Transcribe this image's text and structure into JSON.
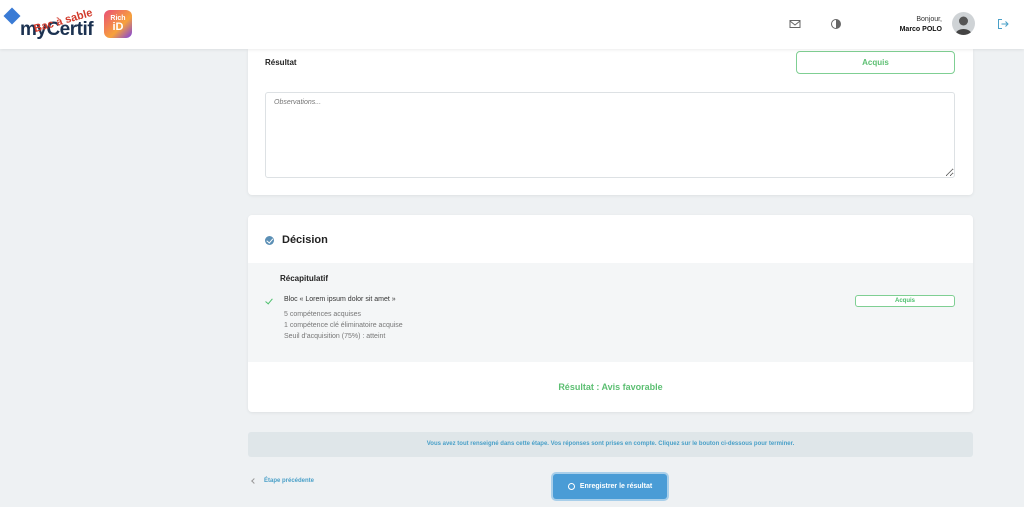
{
  "header": {
    "logo_text": "myCertif",
    "logo_sandbox": "Bac à sable",
    "richid_top": "Rich",
    "richid_bottom": "iD",
    "greeting": "Bonjour,",
    "user_name": "Marco POLO",
    "icons": [
      "mail-icon",
      "theme-toggle-icon",
      "logout-icon"
    ]
  },
  "result_section": {
    "label": "Résultat",
    "status_button": "Acquis",
    "observations_placeholder": "Observations..."
  },
  "decision": {
    "title": "Décision",
    "recap_title": "Récapitulatif",
    "bloc": {
      "name": "Bloc « Lorem ipsum dolor sit amet »",
      "lines": [
        "5 compétences acquises",
        "1 compétence clé éliminatoire acquise",
        "Seuil d'acquisition (75%) : atteint"
      ],
      "status": "Acquis"
    },
    "result": "Résultat : Avis favorable"
  },
  "info_message": "Vous avez tout renseigné dans cette étape. Vos réponses sont prises en compte. Cliquez sur le bouton ci-dessous pour terminer.",
  "footer": {
    "previous_label": "Étape précédente",
    "save_label": "Enregistrer le résultat"
  },
  "colors": {
    "accent": "#4a9cd6",
    "success": "#5cbf72",
    "background": "#eef1f3"
  }
}
